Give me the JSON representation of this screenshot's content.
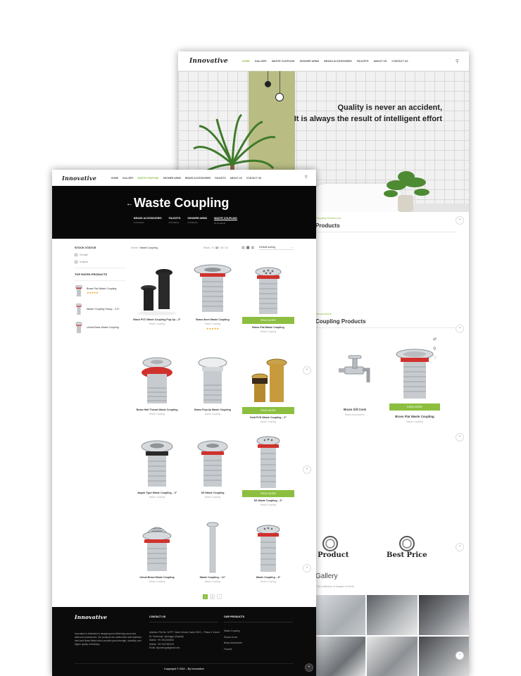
{
  "back_page": {
    "logo": "Innovative",
    "nav": [
      "HOME",
      "GALLERY",
      "WASTE COUPLING",
      "SHOWER ARMS",
      "BRASS ACCESSORIES",
      "FAUCETS",
      "ABOUT US",
      "CONTACT US"
    ],
    "hero_quote_line1": "Quality is never an accident,",
    "hero_quote_line2": "It is always the result of intelligent effort",
    "section1_sub": "Coupling Showroom",
    "section1_title": "Products",
    "section2_sub": "Introductions",
    "section2_title": "Coupling Products",
    "products": [
      {
        "name": "Brass Sill Cock",
        "category": "Brass Accessories"
      },
      {
        "name": "Brass Flat Waste Coupling",
        "category": "Waste Coupling",
        "button": "READ MORE"
      }
    ],
    "badges": [
      "t Product",
      "Best Price"
    ],
    "gallery_title": "Gallery",
    "gallery_sub": "...the collection of images of Gents"
  },
  "front_page": {
    "logo": "Innovative",
    "nav": [
      "HOME",
      "GALLERY",
      "WASTE COUPLING",
      "SHOWER ARMS",
      "BRASS ACCESSORIES",
      "FAUCETS",
      "ABOUT US",
      "CONTACT US"
    ],
    "nav_active": "WASTE COUPLING",
    "title": "Waste Coupling",
    "back_arrow": "←",
    "categories": [
      {
        "name": "BRASS ACCESSORIES",
        "count": "1 Products"
      },
      {
        "name": "FAUCETS",
        "count": "0 Products"
      },
      {
        "name": "SHOWER ARMS",
        "count": "3 Products"
      },
      {
        "name": "WASTE COUPLING",
        "count": "21 Products",
        "active": true
      }
    ],
    "sidebar": {
      "stock_heading": "STOCK STATUS",
      "stock_options": [
        "On sale",
        "In stock"
      ],
      "top_rated_heading": "TOP RATED PRODUCTS",
      "top_rated": [
        {
          "name": "Brass Flat Waste Coupling",
          "stars": "★★★★★"
        },
        {
          "name": "Waste Coupling Heavy – 3.5\"",
          "stars": ""
        },
        {
          "name": "Urinal Brass Waste Coupling",
          "stars": ""
        }
      ]
    },
    "toolbar": {
      "breadcrumb_home": "Home",
      "breadcrumb_sep": "/",
      "breadcrumb_current": "Waste Coupling",
      "show_label": "Show :",
      "show_options": [
        "9",
        "12",
        "18",
        "24"
      ],
      "show_current": "12",
      "sort_value": "Default sorting"
    },
    "products": [
      {
        "name": "Black PVC Waste Coupling Pop-Up – 3\"",
        "category": "Waste Coupling",
        "stars": "",
        "button": ""
      },
      {
        "name": "Brass 8mm Waste Coupling",
        "category": "Waste Coupling",
        "stars": "★★★★★",
        "button": ""
      },
      {
        "name": "Brass Flat Waste Coupling",
        "category": "Waste Coupling",
        "stars": "",
        "button": "READ MORE"
      },
      {
        "name": "Brass Half Thread Waste Coupling",
        "category": "Waste Coupling",
        "stars": "",
        "button": ""
      },
      {
        "name": "Brass Pop-Up Waste Coupling",
        "category": "Waste Coupling",
        "stars": "",
        "button": ""
      },
      {
        "name": "Gold PVD Waste Coupling – 3\"",
        "category": "Waste Coupling",
        "stars": "",
        "button": "READ MORE"
      },
      {
        "name": "Jaquar Type Waste Coupling – 3\"",
        "category": "Waste Coupling",
        "stars": "",
        "button": ""
      },
      {
        "name": "SS Waste Coupling",
        "category": "Waste Coupling",
        "stars": "",
        "button": ""
      },
      {
        "name": "SS Waste Coupling – 5\"",
        "category": "Waste Coupling",
        "stars": "",
        "button": "READ MORE"
      },
      {
        "name": "Urinal Brass Waste Coupling",
        "category": "Waste Coupling",
        "stars": "",
        "button": ""
      },
      {
        "name": "Waste Coupling – 12\"",
        "category": "Waste Coupling",
        "stars": "",
        "button": ""
      },
      {
        "name": "Waste Coupling – 8\"",
        "category": "Waste Coupling",
        "stars": "",
        "button": ""
      }
    ],
    "pagination": [
      "1",
      "2",
      "›"
    ],
    "pagination_current": "1",
    "footer": {
      "logo": "Innovative",
      "about": "Innovative is dedicated to designing and delivering sound and bathroom accessories. Our products are crafted with solid stainless steel and Brass Metal which provides great strength, durability, and higher quality of finishing.",
      "contact_title": "CONTACT US",
      "contact_lines": [
        "Address: Plot No. B-PF7, Ward Chowk, Dared GIDC – Phase 4, Dared Nr. Panchmal, Jamnagar (Gujarat)",
        "Mobile: +91 9512345002",
        "Mobile: +91 9427383470",
        "Email: kdproinngo@gmail.com"
      ],
      "products_title": "OUR PRODUCTS",
      "product_links": [
        "Waste Coupling",
        "Shower Arms",
        "Brass Accessories",
        "Faucets"
      ],
      "copyright": "Copyright © 2022 – By Innovative"
    }
  },
  "colors": {
    "accent": "#8cbf3f",
    "dark": "#080808",
    "star": "#e8a317"
  }
}
